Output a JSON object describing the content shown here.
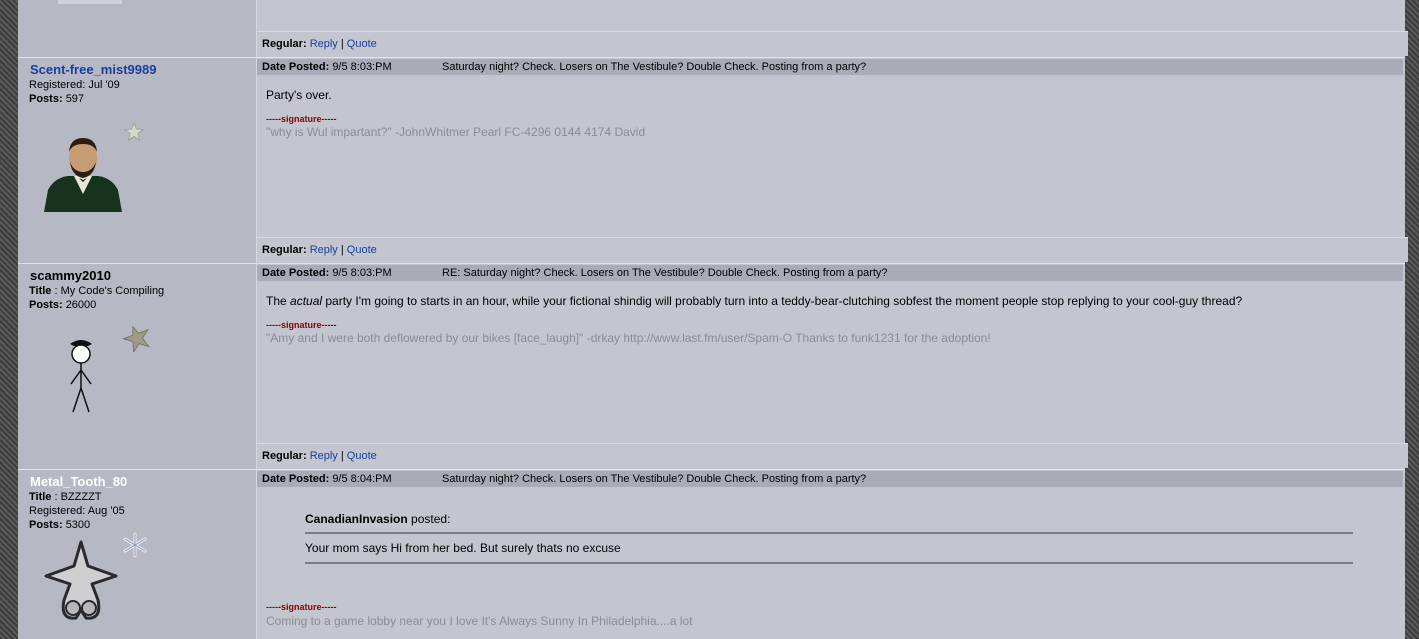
{
  "footer": {
    "regular_label": "Regular:",
    "reply_label": "Reply",
    "sep": "|",
    "quote_label": "Quote"
  },
  "posts": [
    {
      "username": "Scent-free_mist9989",
      "username_color": "#1a3fa0",
      "info": [
        {
          "label": "Registered:",
          "value": "Jul '09"
        },
        {
          "label": "Posts:",
          "value": "597"
        }
      ],
      "date_label": "Date Posted:",
      "date": "9/5 8:03:PM",
      "subject": "Saturday night? Check. Losers on The Vestibule? Double Check. Posting from a party?",
      "body": "Party's over.",
      "signature_label": "-----signature-----",
      "signature": "\"why is Wul impartant?\" -JohnWhitmer Pearl FC-4296 0144 4174 David",
      "avatar_icon": "lincoln-portrait-avatar",
      "badge_icon": "star-badge-icon"
    },
    {
      "username": "scammy2010",
      "username_color": "#000000",
      "info": [
        {
          "label": "Title",
          "value": ": My Code's Compiling"
        },
        {
          "label": "Posts:",
          "value": "26000"
        }
      ],
      "date_label": "Date Posted:",
      "date": "9/5 8:03:PM",
      "subject": "RE: Saturday night? Check. Losers on The Vestibule? Double Check. Posting from a party?",
      "body_pre": "The ",
      "body_em": "actual",
      "body_post": " party I'm going to starts in an hour, while your fictional shindig will probably turn into a teddy-bear-clutching sobfest the moment people stop replying to your cool-guy thread?",
      "signature_label": "-----signature-----",
      "signature": "\"Amy and I were both deflowered by our bikes [face_laugh]\" -drkay http://www.last.fm/user/Spam-O Thanks to funk1231 for the adoption!",
      "avatar_icon": "stick-figure-avatar",
      "badge_icon": "star-badge-icon"
    },
    {
      "username": "Metal_Tooth_80",
      "username_color": "#ffffff",
      "info": [
        {
          "label": "Title",
          "value": ": BZZZZT"
        },
        {
          "label": "Registered:",
          "value": "Aug '05"
        },
        {
          "label": "Posts:",
          "value": "5300"
        }
      ],
      "date_label": "Date Posted:",
      "date": "9/5 8:04:PM",
      "subject": "Saturday night? Check. Losers on The Vestibule? Double Check. Posting from a party?",
      "quote_author": "CanadianInvasion",
      "quote_posted": " posted:",
      "quote_text": "Your mom says Hi from her bed. But surely thats no excuse",
      "signature_label": "-----signature-----",
      "signature": "Coming to a game lobby near you I love It's Always Sunny In Philadelphia....a lot",
      "avatar_icon": "nobody-emblem-avatar",
      "badge_icon": "snowflake-badge-icon"
    }
  ]
}
